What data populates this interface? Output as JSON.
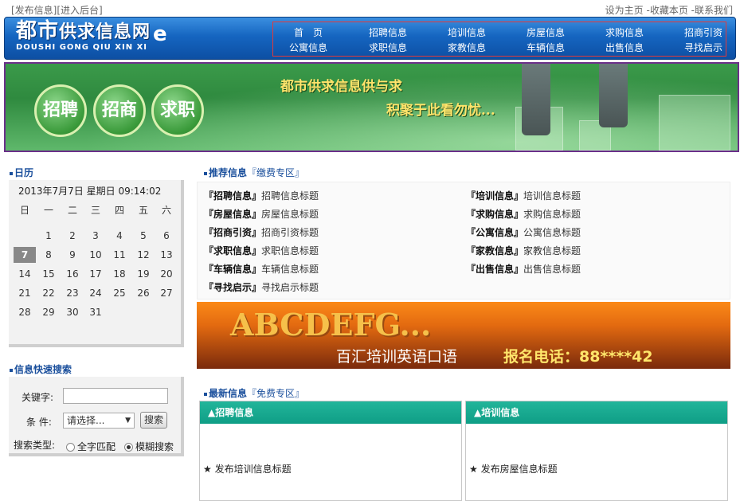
{
  "topbar": {
    "left": [
      "[发布信息]",
      "[进入后台]"
    ],
    "right": [
      "设为主页",
      "-收藏本页",
      "-联系我们"
    ]
  },
  "logo": {
    "cn_main": "都市",
    "cn_rest": "供求信息网",
    "en": "DOUSHI  GONG QIU XIN XI",
    "mark": "e"
  },
  "nav": {
    "row1": [
      "首　页",
      "招聘信息",
      "培训信息",
      "房屋信息",
      "求购信息",
      "招商引资"
    ],
    "row2": [
      "公寓信息",
      "求职信息",
      "家教信息",
      "车辆信息",
      "出售信息",
      "寻找启示"
    ]
  },
  "banner": {
    "buttons": [
      "招聘",
      "招商",
      "求职"
    ],
    "slogan1": "都市供求信息供与求",
    "slogan2": "积聚于此看勿忧..."
  },
  "calendar": {
    "title": "日历",
    "date_line": "2013年7月7日  星期日  09:14:02",
    "weekdays": [
      "日",
      "一",
      "二",
      "三",
      "四",
      "五",
      "六"
    ],
    "weeks": [
      [
        "",
        "1",
        "2",
        "3",
        "4",
        "5",
        "6"
      ],
      [
        "7",
        "8",
        "9",
        "10",
        "11",
        "12",
        "13"
      ],
      [
        "14",
        "15",
        "16",
        "17",
        "18",
        "19",
        "20"
      ],
      [
        "21",
        "22",
        "23",
        "24",
        "25",
        "26",
        "27"
      ],
      [
        "28",
        "29",
        "30",
        "31",
        "",
        "",
        ""
      ]
    ],
    "today": "7"
  },
  "search": {
    "title": "信息快速搜索",
    "keyword_label": "关键字:",
    "keyword_value": "",
    "condition_label": "条  件:",
    "condition_value": "请选择...",
    "button": "搜索",
    "type_label": "搜索类型:",
    "type_options": [
      "全字匹配",
      "模糊搜索"
    ],
    "type_selected": "模糊搜索"
  },
  "recommended": {
    "title": "推荐信息",
    "subtitle": "『缴费专区』",
    "items": [
      {
        "tag": "『招聘信息』",
        "text": "招聘信息标题"
      },
      {
        "tag": "『培训信息』",
        "text": "培训信息标题"
      },
      {
        "tag": "『房屋信息』",
        "text": "房屋信息标题"
      },
      {
        "tag": "『求购信息』",
        "text": "求购信息标题"
      },
      {
        "tag": "『招商引资』",
        "text": "招商引资标题"
      },
      {
        "tag": "『公寓信息』",
        "text": "公寓信息标题"
      },
      {
        "tag": "『求职信息』",
        "text": "求职信息标题"
      },
      {
        "tag": "『家教信息』",
        "text": "家教信息标题"
      },
      {
        "tag": "『车辆信息』",
        "text": "车辆信息标题"
      },
      {
        "tag": "『出售信息』",
        "text": "出售信息标题"
      },
      {
        "tag": "『寻找启示』",
        "text": "寻找启示标题"
      }
    ]
  },
  "ad": {
    "big": "ABCDEFG...",
    "line1": "百汇培训英语口语",
    "line2": "报名电话：88****42"
  },
  "latest": {
    "title": "最新信息",
    "subtitle": "『免费专区』",
    "panels": [
      {
        "head": "▲招聘信息",
        "item": "★ 发布培训信息标题"
      },
      {
        "head": "▲培训信息",
        "item": "★ 发布房屋信息标题"
      }
    ]
  }
}
